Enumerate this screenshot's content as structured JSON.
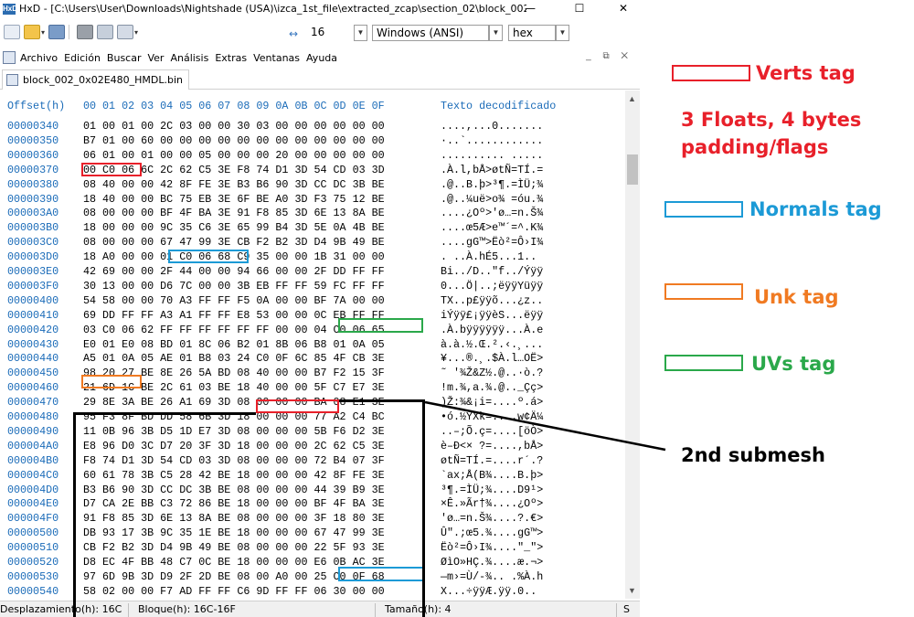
{
  "window": {
    "title": "HxD - [C:\\Users\\User\\Downloads\\Nightshade (USA)\\izca_1st_file\\extracted_zcap\\section_02\\block_002...",
    "minimize": "—",
    "maximize": "☐",
    "close": "✕"
  },
  "toolbar": {
    "bytes_per_row": "16",
    "charset": "Windows (ANSI)",
    "offset_base": "hex"
  },
  "menu": [
    "Archivo",
    "Edición",
    "Buscar",
    "Ver",
    "Análisis",
    "Extras",
    "Ventanas",
    "Ayuda"
  ],
  "mdi_controls": "_ ⧉ ✕",
  "tab": {
    "label": "block_002_0x02E480_HMDL.bin"
  },
  "header": {
    "offset": "Offset(h)",
    "columns": "00 01 02 03 04 05 06 07 08 09 0A 0B 0C 0D 0E 0F",
    "text": "Texto decodificado"
  },
  "rows": [
    {
      "offset": "00000340",
      "hex": "01 00 01 00 2C 03 00 00 30 03 00 00 00 00 00 00",
      "text": "....,...0......."
    },
    {
      "offset": "00000350",
      "hex": "B7 01 00 60 00 00 00 00 00 00 00 00 00 00 00 00",
      "text": "·..`............"
    },
    {
      "offset": "00000360",
      "hex": "06 01 00 01 00 00 05 00 00 00 20 00 00 00 00 00",
      "text": ".......... ....."
    },
    {
      "offset": "00000370",
      "hex": "00 C0 06 6C 2C 62 C5 3E F8 74 D1 3D 54 CD 03 3D",
      "text": ".À.l,bÅ>øtÑ=TÍ.="
    },
    {
      "offset": "00000380",
      "hex": "08 40 00 00 42 8F FE 3E B3 B6 90 3D CC DC 3B BE",
      "text": ".@..B.þ>³¶.=ÌÜ;¾"
    },
    {
      "offset": "00000390",
      "hex": "18 40 00 00 BC 75 EB 3E 6F BE A0 3D F3 75 12 BE",
      "text": ".@..¼uë>o¾ =óu.¾"
    },
    {
      "offset": "000003A0",
      "hex": "08 00 00 00 BF 4F BA 3E 91 F8 85 3D 6E 13 8A BE",
      "text": "....¿Oº>'ø…=n.Š¾"
    },
    {
      "offset": "000003B0",
      "hex": "18 00 00 00 9C 35 C6 3E 65 99 B4 3D 5E 0A 4B BE",
      "text": "....œ5Æ>e™´=^.K¾"
    },
    {
      "offset": "000003C0",
      "hex": "08 00 00 00 67 47 99 3E CB F2 B2 3D D4 9B 49 BE",
      "text": "....gG™>Ëò²=Ô›I¾"
    },
    {
      "offset": "000003D0",
      "hex": "18 A0 00 00 01 C0 06 68 C9 35 00 00 1B 31 00 00",
      "text": ". ..À.hÉ5...1.."
    },
    {
      "offset": "000003E0",
      "hex": "42 69 00 00 2F 44 00 00 94 66 00 00 2F DD FF FF",
      "text": "Bi../D..\"f../Ýÿÿ"
    },
    {
      "offset": "000003F0",
      "hex": "30 13 00 00 D6 7C 00 00 3B EB FF FF 59 FC FF FF",
      "text": "0...Ö|..;ëÿÿYüÿÿ"
    },
    {
      "offset": "00000400",
      "hex": "54 58 00 00 70 A3 FF FF F5 0A 00 00 BF 7A 00 00",
      "text": "TX..p£ÿÿõ...¿z.."
    },
    {
      "offset": "00000410",
      "hex": "69 DD FF FF A3 A1 FF FF E8 53 00 00 0C EB FF FF",
      "text": "iÝÿÿ£¡ÿÿèS...ëÿÿ"
    },
    {
      "offset": "00000420",
      "hex": "03 C0 06 62 FF FF FF FF FF FF 00 00 04 C0 06 65",
      "text": ".À.bÿÿÿÿÿÿ...À.e"
    },
    {
      "offset": "00000430",
      "hex": "E0 01 E0 08 BD 01 8C 06 B2 01 8B 06 B8 01 0A 05",
      "text": "à.à.½.Œ.².‹.¸..."
    },
    {
      "offset": "00000440",
      "hex": "A5 01 0A 05 AE 01 B8 03 24 C0 0F 6C 85 4F CB 3E",
      "text": "¥...®.¸.$À.l…OË>"
    },
    {
      "offset": "00000450",
      "hex": "98 20 27 BE 8E 26 5A BD 08 40 00 00 B7 F2 15 3F",
      "text": "˜ '¾Ž&Z½.@..·ò.?"
    },
    {
      "offset": "00000460",
      "hex": "21 6D 1C BE 2C 61 03 BE 18 40 00 00 5F C7 E7 3E",
      "text": "!m.¾,a.¾.@.._Çç>"
    },
    {
      "offset": "00000470",
      "hex": "29 8E 3A BE 26 A1 69 3D 08 00 00 00 BA 08 E1 3E",
      "text": ")Ž:¾&¡i=....º.á>"
    },
    {
      "offset": "00000480",
      "hex": "95 F3 8F BD DD 58 6B 3D 18 00 00 00 77 A2 C4 BC",
      "text": "•ó.½ÝXk=....w¢Ä¼"
    },
    {
      "offset": "00000490",
      "hex": "11 0B 96 3B D5 1D E7 3D 08 00 00 00 5B F6 D2 3E",
      "text": "..–;Õ.ç=....[öÒ>"
    },
    {
      "offset": "000004A0",
      "hex": "E8 96 D0 3C D7 20 3F 3D 18 00 00 00 2C 62 C5 3E",
      "text": "è–Ð<× ?=....,bÅ>"
    },
    {
      "offset": "000004B0",
      "hex": "F8 74 D1 3D 54 CD 03 3D 08 00 00 00 72 B4 07 3F",
      "text": "øtÑ=TÍ.=....r´.?"
    },
    {
      "offset": "000004C0",
      "hex": "60 61 78 3B C5 28 42 BE 18 00 00 00 42 8F FE 3E",
      "text": "`ax;Å(B¾....B.þ>"
    },
    {
      "offset": "000004D0",
      "hex": "B3 B6 90 3D CC DC 3B BE 08 00 00 00 44 39 B9 3E",
      "text": "³¶.=ÌÜ;¾....D9¹>"
    },
    {
      "offset": "000004E0",
      "hex": "D7 CA 2E BB C3 72 86 BE 18 00 00 00 BF 4F BA 3E",
      "text": "×Ê.»Ãr†¾....¿Oº>"
    },
    {
      "offset": "000004F0",
      "hex": "91 F8 85 3D 6E 13 8A BE 08 00 00 00 3F 18 80 3E",
      "text": "'ø…=n.Š¾....?.€>"
    },
    {
      "offset": "00000500",
      "hex": "DB 93 17 3B 9C 35 1E BE 18 00 00 00 67 47 99 3E",
      "text": "Û\".;œ5.¾....gG™>"
    },
    {
      "offset": "00000510",
      "hex": "CB F2 B2 3D D4 9B 49 BE 08 00 00 00 22 5F 93 3E",
      "text": "Ëò²=Ô›I¾....\"_\">"
    },
    {
      "offset": "00000520",
      "hex": "D8 EC 4F BB 48 C7 0C BE 18 00 00 00 E6 0B AC 3E",
      "text": "ØìO»HÇ.¾....æ.¬>"
    },
    {
      "offset": "00000530",
      "hex": "97 6D 9B 3D D9 2F 2D BE 08 00 A0 00 25 C0 0F 68",
      "text": "—m›=Ù/-¾.. .%À.h"
    },
    {
      "offset": "00000540",
      "hex": "58 02 00 00 F7 AD FF FF C6 9D FF FF 06 30 00 00",
      "text": "X...÷­ÿÿÆ.ÿÿ.0.."
    }
  ],
  "status": {
    "offset": "Desplazamiento(h): 16C",
    "block": "Bloque(h): 16C-16F",
    "size": "Tamaño(h): 4",
    "extra": "S"
  },
  "annotations": {
    "verts_label": "Verts tag",
    "verts_note": "3 Floats, 4 bytes\npadding/flags",
    "normals_label": "Normals tag",
    "unk_label": "Unk tag",
    "uvs_label": "UVs tag",
    "submesh_label": "2nd submesh",
    "colors": {
      "verts": "#e8202a",
      "normals": "#1c9ad6",
      "unk": "#f07a22",
      "uvs": "#2aa84a",
      "submesh": "#000000"
    }
  }
}
